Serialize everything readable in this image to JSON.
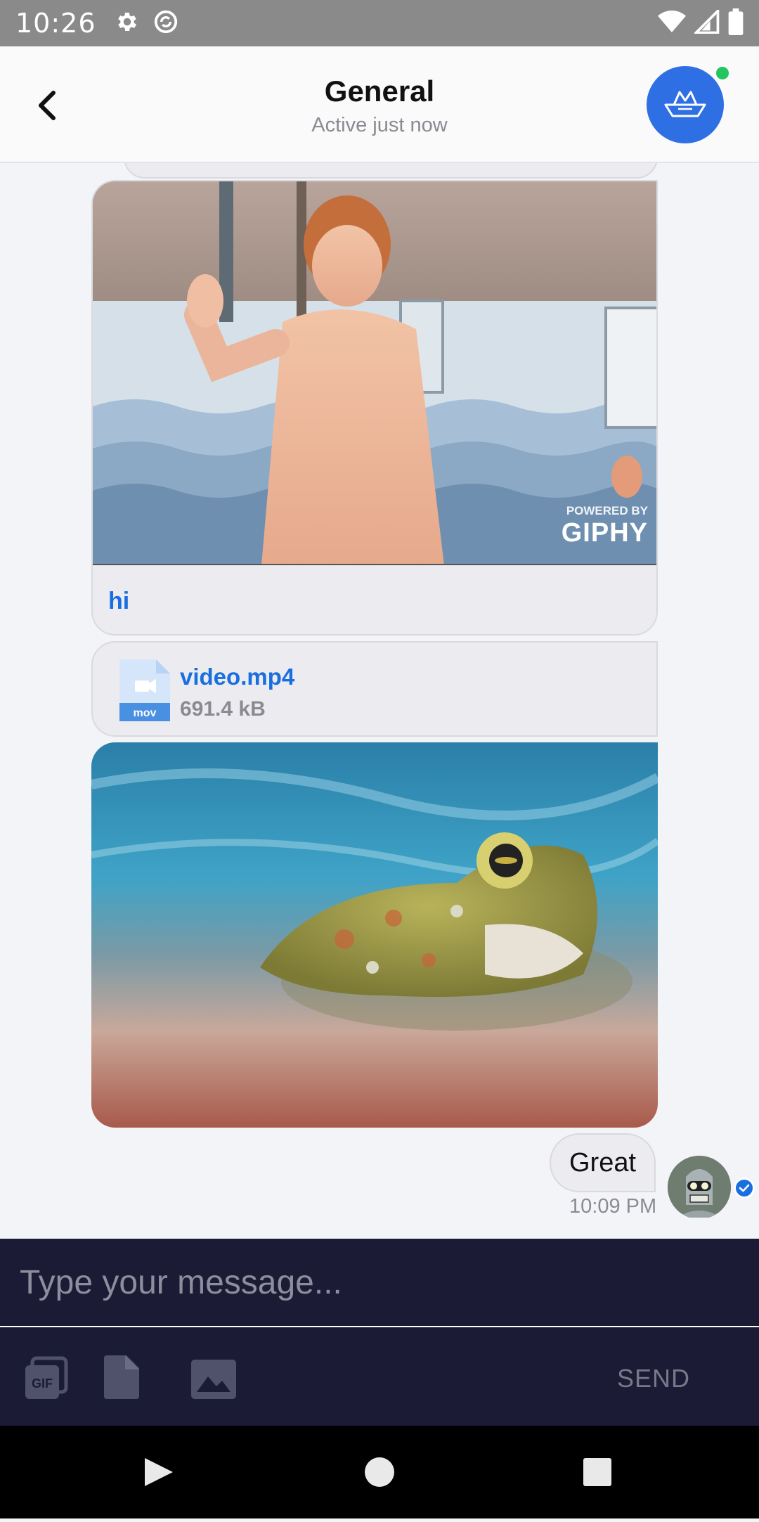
{
  "status_bar": {
    "time": "10:26"
  },
  "header": {
    "title": "General",
    "subtitle": "Active just now"
  },
  "messages": {
    "gif": {
      "caption": "hi",
      "powered_by": "POWERED BY",
      "giphy": "GIPHY"
    },
    "file": {
      "name": "video.mp4",
      "size": "691.4 kB",
      "ext": "mov"
    },
    "text": {
      "body": "Great",
      "time": "10:09 PM"
    }
  },
  "composer": {
    "placeholder": "Type your message...",
    "send_label": "SEND"
  },
  "icons": {
    "back": "chevron-left-icon",
    "gif": "gif-icon",
    "file": "file-icon",
    "image": "image-icon",
    "settings": "gear-icon",
    "sync": "sync-icon",
    "wifi": "wifi-icon",
    "signal": "signal-icon",
    "battery": "battery-icon"
  },
  "colors": {
    "accent": "#1a6fe0",
    "avatar_bg": "#2f6fe4",
    "composer_bg": "#1c1b36",
    "online": "#22c55e"
  }
}
